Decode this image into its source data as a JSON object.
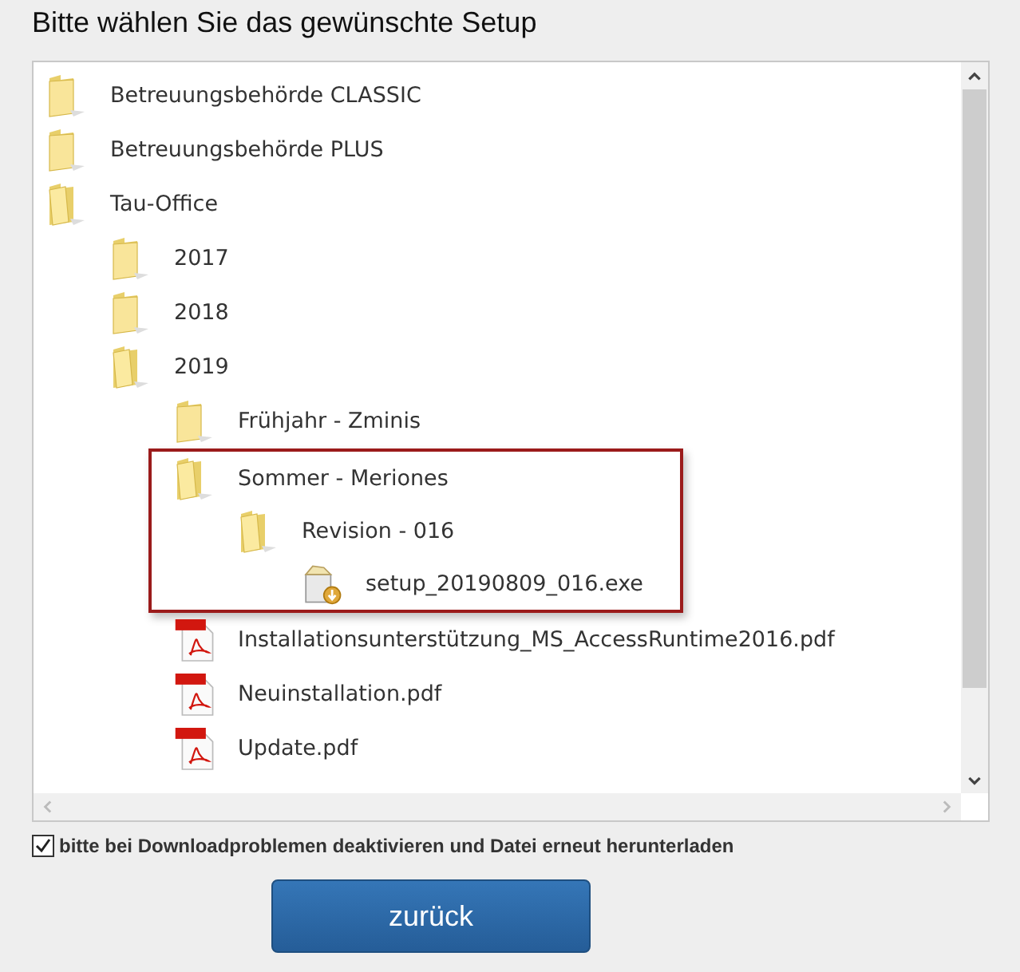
{
  "title": "Bitte wählen Sie das gewünschte Setup",
  "tree": [
    {
      "kind": "folder",
      "label": "Betreuungsbehörde CLASSIC",
      "expanded": false
    },
    {
      "kind": "folder",
      "label": "Betreuungsbehörde PLUS",
      "expanded": false
    },
    {
      "kind": "folder",
      "label": "Tau-Office",
      "expanded": true,
      "children": [
        {
          "kind": "folder",
          "label": "2017",
          "expanded": false
        },
        {
          "kind": "folder",
          "label": "2018",
          "expanded": false
        },
        {
          "kind": "folder",
          "label": "2019",
          "expanded": true,
          "children": [
            {
              "kind": "folder",
              "label": "Frühjahr - Zminis",
              "expanded": false
            },
            {
              "kind": "folder",
              "label": "Sommer - Meriones",
              "expanded": true,
              "highlighted": true,
              "children": [
                {
                  "kind": "folder",
                  "label": "Revision - 016",
                  "expanded": true,
                  "children": [
                    {
                      "kind": "exe",
                      "label": "setup_20190809_016.exe"
                    }
                  ]
                }
              ]
            },
            {
              "kind": "pdf",
              "label": "Installationsunterstützung_MS_AccessRuntime2016.pdf"
            },
            {
              "kind": "pdf",
              "label": "Neuinstallation.pdf"
            },
            {
              "kind": "pdf",
              "label": "Update.pdf"
            }
          ]
        }
      ]
    }
  ],
  "download_option": {
    "label": "bitte bei Downloadproblemen deaktivieren und Datei erneut herunterladen",
    "checked": true
  },
  "back_button": "zurück"
}
